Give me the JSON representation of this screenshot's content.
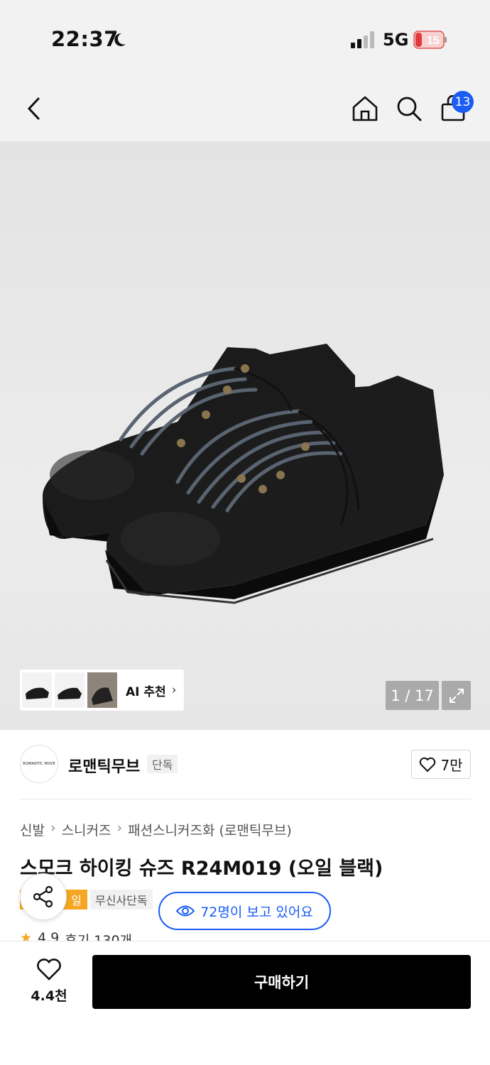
{
  "status": {
    "time": "22:37",
    "network": "5G",
    "battery": "15"
  },
  "nav": {
    "cart_count": "13"
  },
  "gallery": {
    "ai_label": "AI 추천",
    "counter": "1 / 17"
  },
  "brand": {
    "name": "로맨틱무브",
    "tag": "단독",
    "logo_text": "ROMANTIC MOVE",
    "likes": "7만"
  },
  "breadcrumb": [
    "신발",
    "스니커즈",
    "패션스니커즈화 (로맨틱무브)"
  ],
  "product": {
    "title": "스모크 하이킹 슈즈 R24M019 (오일 블랙)",
    "badge_sale": "일",
    "badge_exclusive": "무신사단독",
    "viewers": "72명이 보고 있어요",
    "rating": "4.9",
    "reviews": "후기 130개"
  },
  "bottom": {
    "wish_count": "4.4천",
    "buy_label": "구매하기"
  },
  "colors": {
    "accent": "#1a5cf4",
    "sale": "#f5a623",
    "buy": "#000000"
  }
}
